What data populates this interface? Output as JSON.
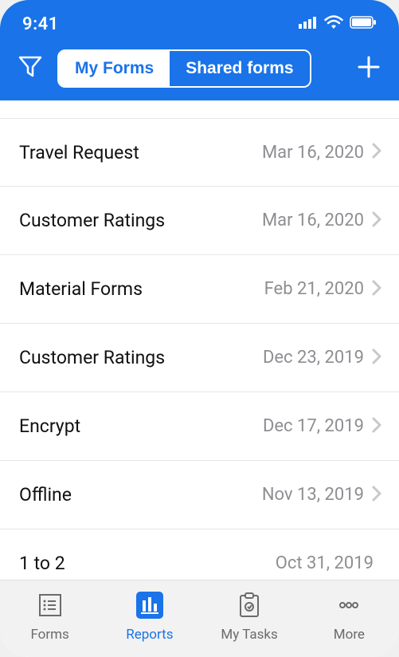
{
  "status": {
    "time": "9:41"
  },
  "tabs": {
    "my_forms": "My Forms",
    "shared_forms": "Shared forms"
  },
  "list": [
    {
      "title": "Travel Request",
      "date": "Mar 16, 2020",
      "chevron": true
    },
    {
      "title": "Customer Ratings",
      "date": "Mar 16, 2020",
      "chevron": true
    },
    {
      "title": "Material Forms",
      "date": "Feb 21, 2020",
      "chevron": true
    },
    {
      "title": "Customer Ratings",
      "date": "Dec 23, 2019",
      "chevron": true
    },
    {
      "title": "Encrypt",
      "date": "Dec 17, 2019",
      "chevron": true
    },
    {
      "title": "Offline",
      "date": "Nov 13, 2019",
      "chevron": true
    },
    {
      "title": "1 to 2",
      "date": "Oct 31, 2019",
      "chevron": false
    }
  ],
  "nav": {
    "forms": "Forms",
    "reports": "Reports",
    "my_tasks": "My Tasks",
    "more": "More"
  }
}
